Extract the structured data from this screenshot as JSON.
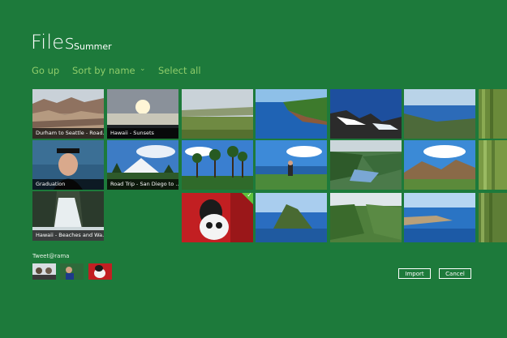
{
  "header": {
    "title": "Files",
    "location": "Summer"
  },
  "commands": {
    "go_up": "Go up",
    "sort_by": "Sort by name",
    "select_all": "Select all"
  },
  "tiles": [
    {
      "caption": "Durham to Seattle - Road..."
    },
    {
      "caption": "Hawaii - Sunsets"
    },
    {
      "caption": "Graduation"
    },
    {
      "caption": "Road Trip - San Diego to ..."
    },
    {
      "caption": "Hawaii - Beaches and Wa..."
    }
  ],
  "selection": {
    "check": "✓"
  },
  "tweet": {
    "label": "Tweet@rama"
  },
  "buttons": {
    "import": "Import",
    "cancel": "Cancel"
  }
}
